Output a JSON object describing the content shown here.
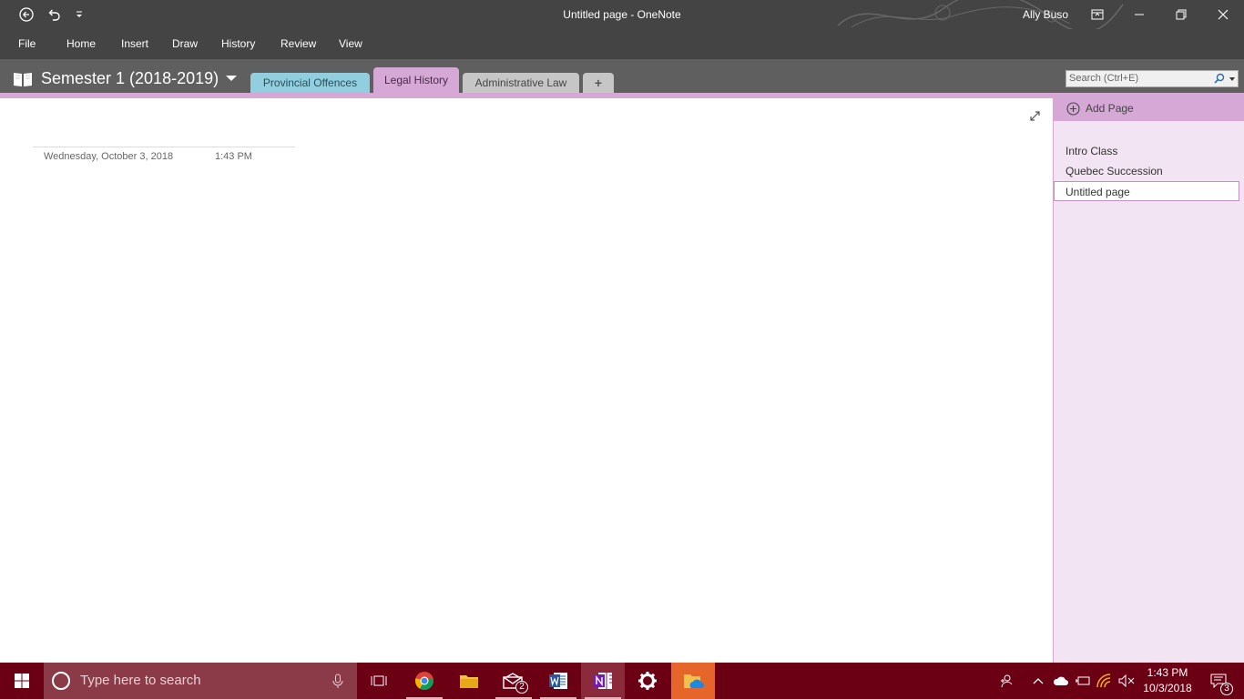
{
  "window": {
    "title": "Untitled page  -  OneNote",
    "user": "Ally Buso"
  },
  "ribbon": {
    "tabs": [
      "File",
      "Home",
      "Insert",
      "Draw",
      "History",
      "Review",
      "View"
    ]
  },
  "notebook": {
    "name": "Semester 1 (2018-2019)",
    "sections": [
      {
        "label": "Provincial Offences",
        "color": "#91cfe0"
      },
      {
        "label": "Legal History",
        "color": "#d6a8d6",
        "selected": true
      },
      {
        "label": "Administrative Law",
        "color": "#c6c6c6"
      }
    ],
    "add_section": "+",
    "search_placeholder": "Search (Ctrl+E)"
  },
  "page": {
    "date": "Wednesday, October 3, 2018",
    "time": "1:43 PM"
  },
  "pages_pane": {
    "add_page_label": "Add Page",
    "pages": [
      "Intro Class",
      "Quebec Succession",
      "Untitled page"
    ],
    "selected_page": "Untitled page"
  },
  "taskbar": {
    "search_placeholder": "Type here to search",
    "apps": [
      "task-view",
      "chrome",
      "file-explorer",
      "mail",
      "word",
      "onenote",
      "settings",
      "onedrive-folder"
    ],
    "mail_badge": "2",
    "clock_time": "1:43 PM",
    "clock_date": "10/3/2018",
    "notification_badge": "3"
  }
}
